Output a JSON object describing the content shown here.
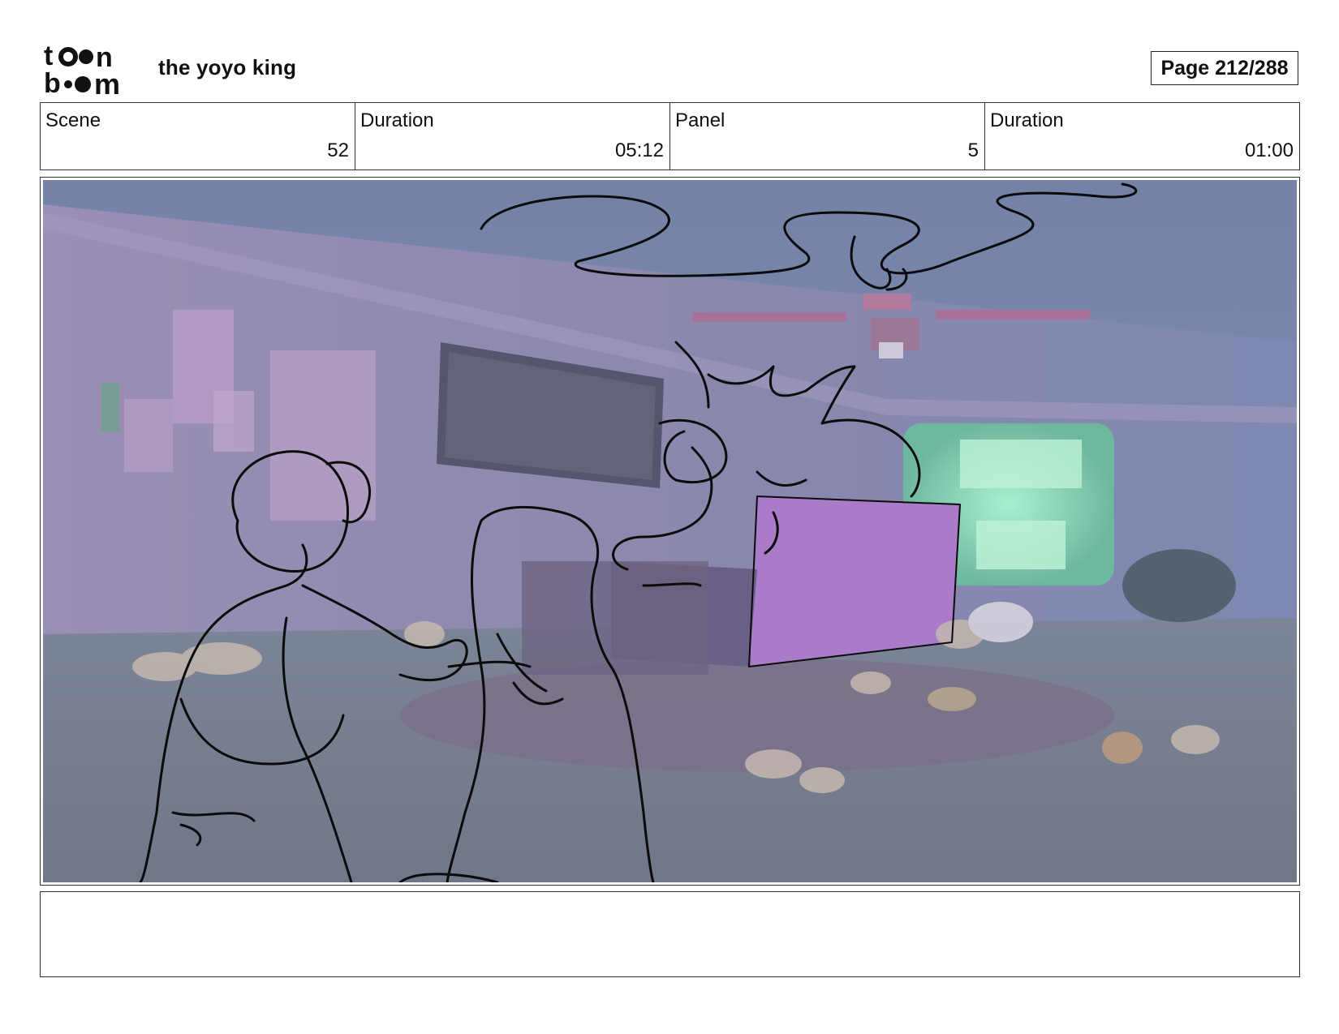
{
  "header": {
    "logo_top": "to●n",
    "logo_bottom": "b●●m",
    "project_title": "the yoyo king",
    "page_label": "Page 212/288"
  },
  "info": [
    {
      "label": "Scene",
      "value": "52"
    },
    {
      "label": "Duration",
      "value": "05:12"
    },
    {
      "label": "Panel",
      "value": "5"
    },
    {
      "label": "Duration",
      "value": "01:00"
    }
  ],
  "panel": {
    "description_icon": "storyboard-sketch-image"
  },
  "notes": {
    "text": ""
  }
}
